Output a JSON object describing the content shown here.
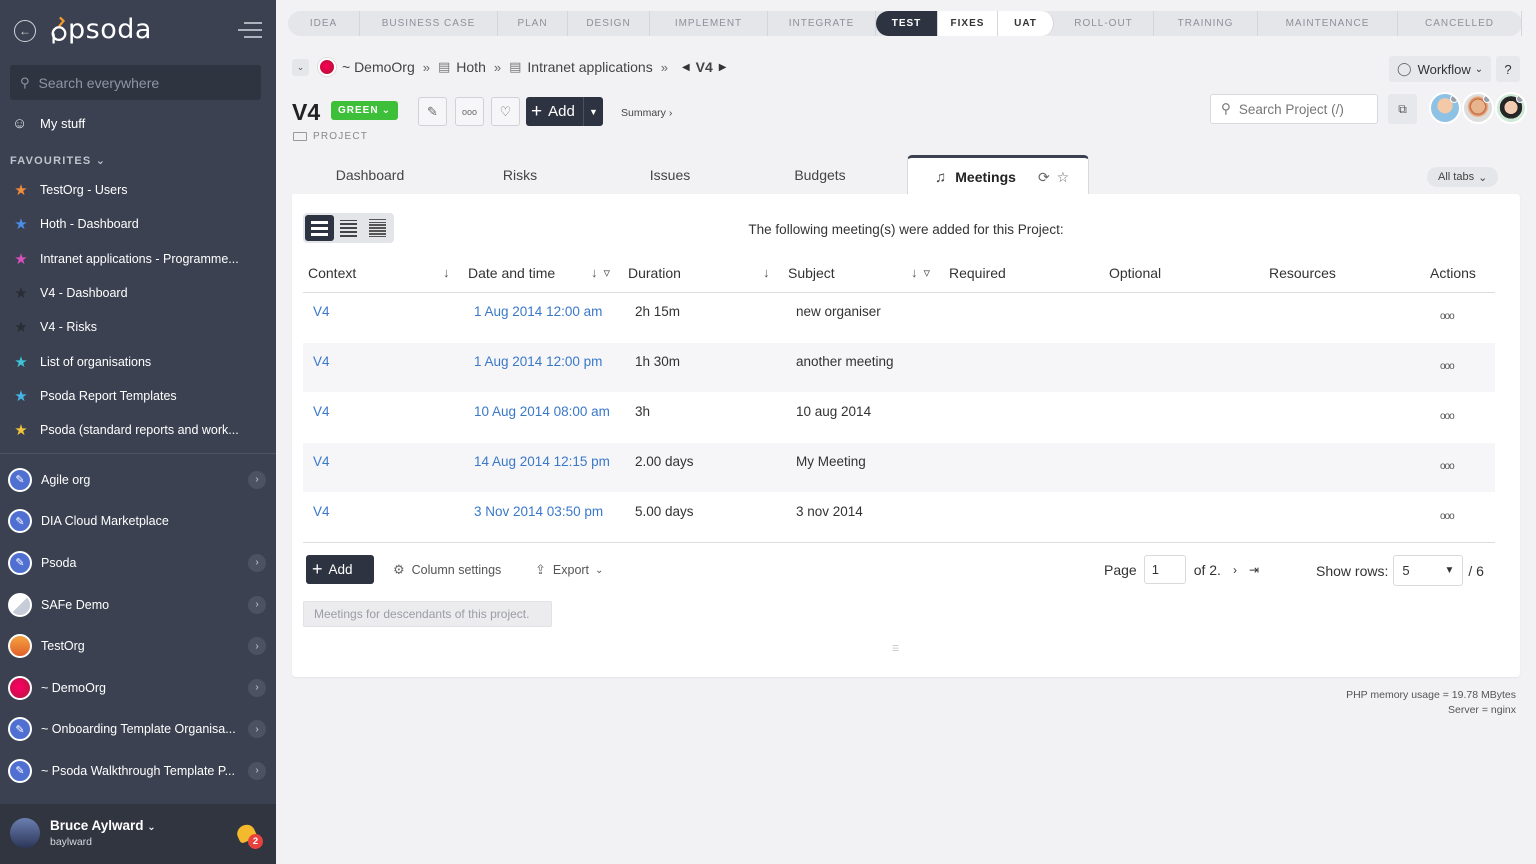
{
  "sidebar": {
    "logo_text": "psoda",
    "search_placeholder": "Search everywhere",
    "my_stuff": "My stuff",
    "favourites_title": "FAVOURITES",
    "favourites": [
      {
        "label": "TestOrg - Users",
        "color": "#f28b3c"
      },
      {
        "label": "Hoth - Dashboard",
        "color": "#4a8ee8"
      },
      {
        "label": "Intranet applications - Programme...",
        "color": "#d94fbf"
      },
      {
        "label": "V4 - Dashboard",
        "color": "#2a2d33"
      },
      {
        "label": "V4 - Risks",
        "color": "#2a2d33"
      },
      {
        "label": "List of organisations",
        "color": "#3ec3d9"
      },
      {
        "label": "Psoda Report Templates",
        "color": "#46b4e8"
      },
      {
        "label": "Psoda (standard reports and work...",
        "color": "#f2c43a"
      }
    ],
    "orgs": [
      {
        "label": "Agile org",
        "arrow": true,
        "kind": "blue"
      },
      {
        "label": "DIA Cloud Marketplace",
        "arrow": false,
        "kind": "blue"
      },
      {
        "label": "Psoda",
        "arrow": true,
        "kind": "blue"
      },
      {
        "label": "SAFe Demo",
        "arrow": true,
        "kind": "safe"
      },
      {
        "label": "TestOrg",
        "arrow": true,
        "kind": "sunset"
      },
      {
        "label": "~ DemoOrg",
        "arrow": true,
        "kind": "red"
      },
      {
        "label": "~ Onboarding Template Organisa...",
        "arrow": true,
        "kind": "blue"
      },
      {
        "label": "~ Psoda Walkthrough Template P...",
        "arrow": true,
        "kind": "blue"
      }
    ],
    "user": {
      "name": "Bruce Aylward",
      "login": "baylward",
      "notifications": "2"
    }
  },
  "stages": [
    {
      "label": "IDEA",
      "state": "before",
      "width": 72
    },
    {
      "label": "BUSINESS CASE",
      "state": "before",
      "width": 138
    },
    {
      "label": "PLAN",
      "state": "before",
      "width": 70
    },
    {
      "label": "DESIGN",
      "state": "before",
      "width": 82
    },
    {
      "label": "IMPLEMENT",
      "state": "before",
      "width": 118
    },
    {
      "label": "INTEGRATE",
      "state": "before",
      "width": 108
    },
    {
      "label": "TEST",
      "state": "active",
      "width": 62
    },
    {
      "label": "FIXES",
      "state": "after",
      "width": 60
    },
    {
      "label": "UAT",
      "state": "after last",
      "width": 56
    },
    {
      "label": "ROLL-OUT",
      "state": "before",
      "width": 100
    },
    {
      "label": "TRAINING",
      "state": "before",
      "width": 104
    },
    {
      "label": "MAINTENANCE",
      "state": "before",
      "width": 140
    },
    {
      "label": "CANCELLED",
      "state": "before",
      "width": 124
    }
  ],
  "breadcrumb": {
    "org": "~ DemoOrg",
    "program": "Hoth",
    "portfolio": "Intranet applications",
    "current": "V4"
  },
  "header": {
    "workflow": "Workflow",
    "help": "?",
    "title": "V4",
    "status": "GREEN",
    "type": "PROJECT",
    "add": "Add",
    "summary": "Summary ›",
    "search_placeholder": "Search Project (/)"
  },
  "tabs": {
    "items": [
      "Dashboard",
      "Risks",
      "Issues",
      "Budgets"
    ],
    "active": "Meetings",
    "all_tabs": "All tabs"
  },
  "panel": {
    "intro": "The following meeting(s) were added for this Project:",
    "columns": [
      "Context",
      "Date and time",
      "Duration",
      "Subject",
      "Required",
      "Optional",
      "Resources",
      "Actions"
    ],
    "rows": [
      {
        "context": "V4",
        "date": "1 Aug 2014 12:00 am",
        "duration": "2h 15m",
        "subject": "new organiser"
      },
      {
        "context": "V4",
        "date": "1 Aug 2014 12:00 pm",
        "duration": "1h 30m",
        "subject": "another meeting"
      },
      {
        "context": "V4",
        "date": "10 Aug 2014 08:00 am",
        "duration": "3h",
        "subject": "10 aug 2014"
      },
      {
        "context": "V4",
        "date": "14 Aug 2014 12:15 pm",
        "duration": "2.00 days",
        "subject": "My Meeting"
      },
      {
        "context": "V4",
        "date": "3 Nov 2014 03:50 pm",
        "duration": "5.00 days",
        "subject": "3 nov 2014"
      }
    ],
    "footer": {
      "add": "Add",
      "column_settings": "Column settings",
      "export": "Export",
      "page_label": "Page",
      "page_value": "1",
      "page_of": "of 2.",
      "show_rows": "Show rows:",
      "rows_value": "5",
      "rows_total": "/ 6"
    },
    "descendants": "Meetings for descendants of this project."
  },
  "server": {
    "memory": "PHP memory usage = 19.78 MBytes",
    "server": "Server = nginx"
  }
}
